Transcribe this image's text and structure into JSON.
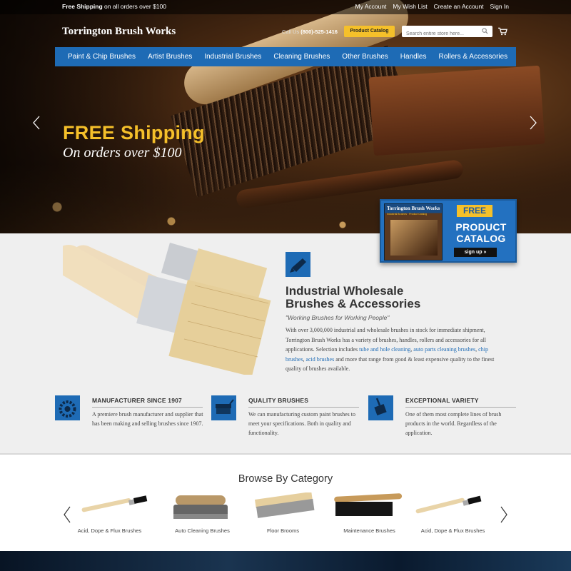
{
  "topbar": {
    "free_bold": "Free Shipping",
    "free_rest": " on all orders over $100",
    "links": [
      "My Account",
      "My Wish List",
      "Create an Account",
      "Sign In"
    ]
  },
  "header": {
    "brand": "Torrington Brush Works",
    "call_prefix": "Call Us ",
    "phone": "(800)-525-1416",
    "catalog_button": "Product Catalog",
    "search_placeholder": "Search entire store here..."
  },
  "nav": [
    "Paint & Chip Brushes",
    "Artist Brushes",
    "Industrial Brushes",
    "Cleaning Brushes",
    "Other Brushes",
    "Handles",
    "Rollers & Accessories"
  ],
  "hero": {
    "headline": "FREE Shipping",
    "subline": "On orders over $100"
  },
  "catalog_promo": {
    "book_title": "Torrington Brush Works",
    "book_subtitle": "Industrial Brushes · Product Catalog",
    "free": "FREE",
    "line1": "PRODUCT",
    "line2": "CATALOG",
    "signup": "sign up »"
  },
  "intro": {
    "heading_line1": "Industrial Wholesale",
    "heading_line2": "Brushes & Accessories",
    "tagline": "\"Working Brushes for Working People\"",
    "text_start": "With over 3,000,000 industrial and wholesale brushes in stock for immediate shipment, Torrington Brush Works has a variety of brushes, handles, rollers and accessories for all applications. Selection includes ",
    "link1": "tube and hole cleaning",
    "sep1": ", ",
    "link2": "auto parts cleaning brushes",
    "sep2": ", ",
    "link3": "chip brushes",
    "sep3": ", ",
    "link4": "acid brushes",
    "text_end": " and more that range from good & least expensive quality to the finest quality of brushes available."
  },
  "features": [
    {
      "title": "MANUFACTURER SINCE 1907",
      "text": "A premiere brush manufacturer and supplier that has been making and selling brushes since 1907.",
      "icon": "gear-icon"
    },
    {
      "title": "QUALITY BRUSHES",
      "text": "We can manufacturing custom paint brushes to meet your specifications. Both in quality and functionality.",
      "icon": "brush-icon"
    },
    {
      "title": "EXCEPTIONAL VARIETY",
      "text": "One of them most complete lines of brush products in the world. Regardless of the application.",
      "icon": "variety-brush-icon"
    }
  ],
  "browse": {
    "title": "Browse By Category",
    "items": [
      "Acid, Dope & Flux Brushes",
      "Auto Cleaning Brushes",
      "Floor Brooms",
      "Maintenance Brushes",
      "Acid, Dope & Flux Brushes"
    ]
  },
  "colors": {
    "brand_blue": "#1e6bb5",
    "accent_yellow": "#f5c02a"
  }
}
